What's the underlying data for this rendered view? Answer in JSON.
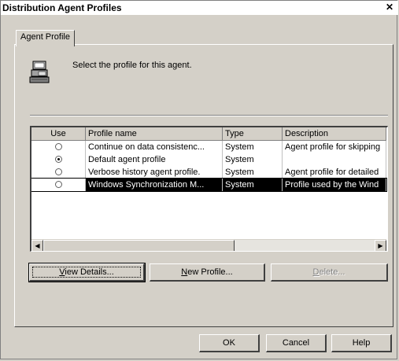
{
  "window": {
    "title": "Distribution Agent Profiles",
    "close_glyph": "✕"
  },
  "tab": {
    "label": "Agent Profile"
  },
  "instruction": "Select the profile for this agent.",
  "grid": {
    "columns": [
      "Use",
      "Profile name",
      "Type",
      "Description"
    ],
    "rows": [
      {
        "use": false,
        "name": "Continue on data consistenc...",
        "type": "System",
        "description": "Agent profile for skipping"
      },
      {
        "use": true,
        "name": "Default agent profile",
        "type": "System",
        "description": ""
      },
      {
        "use": false,
        "name": "Verbose history agent profile.",
        "type": "System",
        "description": "Agent profile for detailed"
      },
      {
        "use": false,
        "name": "Windows Synchronization M...",
        "type": "System",
        "description": "Profile used by the Wind"
      }
    ],
    "selected_row": 3
  },
  "buttons": {
    "view_details": {
      "accel": "V",
      "rest": "iew Details..."
    },
    "new_profile": {
      "accel": "N",
      "rest": "ew Profile..."
    },
    "delete": {
      "accel": "D",
      "rest": "elete..."
    },
    "ok": "OK",
    "cancel": "Cancel",
    "help": "Help"
  },
  "icons": {
    "agent": "agent-computer-icon",
    "scroll_left": "arrow-left-icon",
    "scroll_right": "arrow-right-icon"
  }
}
